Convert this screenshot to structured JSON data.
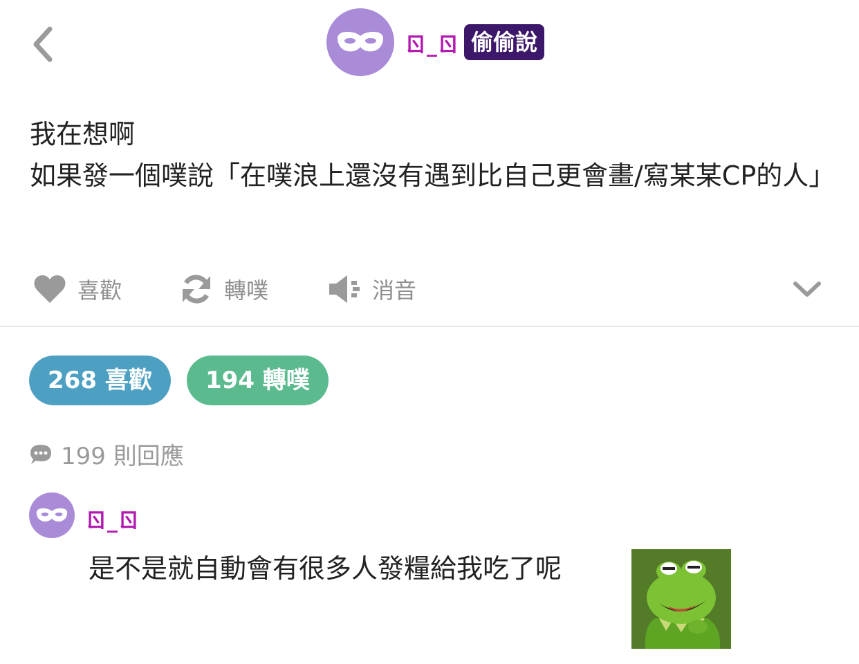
{
  "header": {
    "username": "ㄖ_ㄖ",
    "badge": "偷偷說"
  },
  "post": {
    "text": "我在想啊\n如果發一個噗說「在噗浪上還沒有遇到比自己更會畫/寫某某CP的人」"
  },
  "actions": {
    "like_label": "喜歡",
    "replurk_label": "轉噗",
    "mute_label": "消音"
  },
  "stats": {
    "likes_label": "268 喜歡",
    "replurks_label": "194 轉噗"
  },
  "responses": {
    "count_label": "199 則回應"
  },
  "reply": {
    "username": "ㄖ_ㄖ",
    "text": "是不是就自動會有很多人發糧給我吃了呢"
  },
  "colors": {
    "avatar": "#a98bd8",
    "username": "#b21ab0",
    "badge_bg": "#3d176a",
    "likes_pill": "#4ea0c2",
    "replurks_pill": "#5cbb8e",
    "muted_gray": "#8f8f8f"
  },
  "icons": {
    "back": "chevron-left-icon",
    "avatar": "mask-icon",
    "like": "heart-icon",
    "replurk": "refresh-icon",
    "mute": "speaker-mute-icon",
    "more": "chevron-down-icon",
    "responses": "speech-bubble-icon",
    "sticker": "kermit-frog-sticker"
  }
}
